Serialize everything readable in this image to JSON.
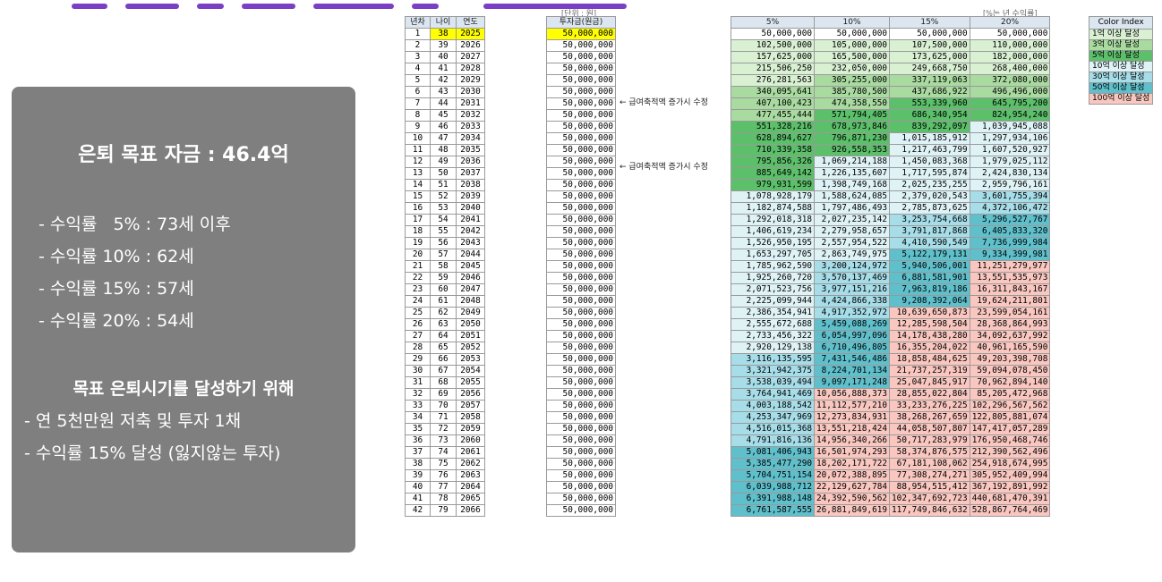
{
  "panel": {
    "title": "은퇴 목표 자금 : 46.4억",
    "rates": [
      "- 수익률   5% : 73세 이후",
      "- 수익률 10% : 62세",
      "- 수익률 15% : 57세",
      "- 수익률 20% : 54세"
    ],
    "goal_heading": "목표 은퇴시기를 달성하기 위해",
    "goals": [
      "- 연 5천만원 저축 및 투자 1채",
      "- 수익률 15% 달성 (잃지않는 투자)"
    ]
  },
  "sheet": {
    "unit_label": "[단위 : 원]",
    "rate_note": "[%는 년 수익률]",
    "headers_left": [
      "년차",
      "나이",
      "연도"
    ],
    "header_invest": "투자금(원금)",
    "headers_rate": [
      "5%",
      "10%",
      "15%",
      "20%"
    ],
    "notes": [
      "← 급여축적액 증가시 수정",
      "← 급여축적액 증가시 수정"
    ],
    "highlight_color": "#ffff00",
    "rows": [
      [
        "1",
        "38",
        "2025",
        "50,000,000",
        "50,000,000",
        "50,000,000",
        "50,000,000",
        "50,000,000"
      ],
      [
        "2",
        "39",
        "2026",
        "50,000,000",
        "102,500,000",
        "105,000,000",
        "107,500,000",
        "110,000,000"
      ],
      [
        "3",
        "40",
        "2027",
        "50,000,000",
        "157,625,000",
        "165,500,000",
        "173,625,000",
        "182,000,000"
      ],
      [
        "4",
        "41",
        "2028",
        "50,000,000",
        "215,506,250",
        "232,050,000",
        "249,668,750",
        "268,400,000"
      ],
      [
        "5",
        "42",
        "2029",
        "50,000,000",
        "276,281,563",
        "305,255,000",
        "337,119,063",
        "372,080,000"
      ],
      [
        "6",
        "43",
        "2030",
        "50,000,000",
        "340,095,641",
        "385,780,500",
        "437,686,922",
        "496,496,000"
      ],
      [
        "7",
        "44",
        "2031",
        "50,000,000",
        "407,100,423",
        "474,358,550",
        "553,339,960",
        "645,795,200"
      ],
      [
        "8",
        "45",
        "2032",
        "50,000,000",
        "477,455,444",
        "571,794,405",
        "686,340,954",
        "824,954,240"
      ],
      [
        "9",
        "46",
        "2033",
        "50,000,000",
        "551,328,216",
        "678,973,846",
        "839,292,097",
        "1,039,945,088"
      ],
      [
        "10",
        "47",
        "2034",
        "50,000,000",
        "628,894,627",
        "796,871,230",
        "1,015,185,912",
        "1,297,934,106"
      ],
      [
        "11",
        "48",
        "2035",
        "50,000,000",
        "710,339,358",
        "926,558,353",
        "1,217,463,799",
        "1,607,520,927"
      ],
      [
        "12",
        "49",
        "2036",
        "50,000,000",
        "795,856,326",
        "1,069,214,188",
        "1,450,083,368",
        "1,979,025,112"
      ],
      [
        "13",
        "50",
        "2037",
        "50,000,000",
        "885,649,142",
        "1,226,135,607",
        "1,717,595,874",
        "2,424,830,134"
      ],
      [
        "14",
        "51",
        "2038",
        "50,000,000",
        "979,931,599",
        "1,398,749,168",
        "2,025,235,255",
        "2,959,796,161"
      ],
      [
        "15",
        "52",
        "2039",
        "50,000,000",
        "1,078,928,179",
        "1,588,624,085",
        "2,379,020,543",
        "3,601,755,394"
      ],
      [
        "16",
        "53",
        "2040",
        "50,000,000",
        "1,182,874,588",
        "1,797,486,493",
        "2,785,873,625",
        "4,372,106,472"
      ],
      [
        "17",
        "54",
        "2041",
        "50,000,000",
        "1,292,018,318",
        "2,027,235,142",
        "3,253,754,668",
        "5,296,527,767"
      ],
      [
        "18",
        "55",
        "2042",
        "50,000,000",
        "1,406,619,234",
        "2,279,958,657",
        "3,791,817,868",
        "6,405,833,320"
      ],
      [
        "19",
        "56",
        "2043",
        "50,000,000",
        "1,526,950,195",
        "2,557,954,522",
        "4,410,590,549",
        "7,736,999,984"
      ],
      [
        "20",
        "57",
        "2044",
        "50,000,000",
        "1,653,297,705",
        "2,863,749,975",
        "5,122,179,131",
        "9,334,399,981"
      ],
      [
        "21",
        "58",
        "2045",
        "50,000,000",
        "1,785,962,590",
        "3,200,124,972",
        "5,940,506,001",
        "11,251,279,977"
      ],
      [
        "22",
        "59",
        "2046",
        "50,000,000",
        "1,925,260,720",
        "3,570,137,469",
        "6,881,581,901",
        "13,551,535,973"
      ],
      [
        "23",
        "60",
        "2047",
        "50,000,000",
        "2,071,523,756",
        "3,977,151,216",
        "7,963,819,186",
        "16,311,843,167"
      ],
      [
        "24",
        "61",
        "2048",
        "50,000,000",
        "2,225,099,944",
        "4,424,866,338",
        "9,208,392,064",
        "19,624,211,801"
      ],
      [
        "25",
        "62",
        "2049",
        "50,000,000",
        "2,386,354,941",
        "4,917,352,972",
        "10,639,650,873",
        "23,599,054,161"
      ],
      [
        "26",
        "63",
        "2050",
        "50,000,000",
        "2,555,672,688",
        "5,459,088,269",
        "12,285,598,504",
        "28,368,864,993"
      ],
      [
        "27",
        "64",
        "2051",
        "50,000,000",
        "2,733,456,322",
        "6,054,997,096",
        "14,178,438,280",
        "34,092,637,992"
      ],
      [
        "28",
        "65",
        "2052",
        "50,000,000",
        "2,920,129,138",
        "6,710,496,805",
        "16,355,204,022",
        "40,961,165,590"
      ],
      [
        "29",
        "66",
        "2053",
        "50,000,000",
        "3,116,135,595",
        "7,431,546,486",
        "18,858,484,625",
        "49,203,398,708"
      ],
      [
        "30",
        "67",
        "2054",
        "50,000,000",
        "3,321,942,375",
        "8,224,701,134",
        "21,737,257,319",
        "59,094,078,450"
      ],
      [
        "31",
        "68",
        "2055",
        "50,000,000",
        "3,538,039,494",
        "9,097,171,248",
        "25,047,845,917",
        "70,962,894,140"
      ],
      [
        "32",
        "69",
        "2056",
        "50,000,000",
        "3,764,941,469",
        "10,056,888,373",
        "28,855,022,804",
        "85,205,472,968"
      ],
      [
        "33",
        "70",
        "2057",
        "50,000,000",
        "4,003,188,542",
        "11,112,577,210",
        "33,233,276,225",
        "102,296,567,562"
      ],
      [
        "34",
        "71",
        "2058",
        "50,000,000",
        "4,253,347,969",
        "12,273,834,931",
        "38,268,267,659",
        "122,805,881,074"
      ],
      [
        "35",
        "72",
        "2059",
        "50,000,000",
        "4,516,015,368",
        "13,551,218,424",
        "44,058,507,807",
        "147,417,057,289"
      ],
      [
        "36",
        "73",
        "2060",
        "50,000,000",
        "4,791,816,136",
        "14,956,340,266",
        "50,717,283,979",
        "176,950,468,746"
      ],
      [
        "37",
        "74",
        "2061",
        "50,000,000",
        "5,081,406,943",
        "16,501,974,293",
        "58,374,876,575",
        "212,390,562,496"
      ],
      [
        "38",
        "75",
        "2062",
        "50,000,000",
        "5,385,477,290",
        "18,202,171,722",
        "67,181,108,062",
        "254,918,674,995"
      ],
      [
        "39",
        "76",
        "2063",
        "50,000,000",
        "5,704,751,154",
        "20,072,388,895",
        "77,308,274,271",
        "305,952,409,994"
      ],
      [
        "40",
        "77",
        "2064",
        "50,000,000",
        "6,039,988,712",
        "22,129,627,784",
        "88,954,515,412",
        "367,192,891,992"
      ],
      [
        "41",
        "78",
        "2065",
        "50,000,000",
        "6,391,988,148",
        "24,392,590,562",
        "102,347,692,723",
        "440,681,470,391"
      ],
      [
        "42",
        "79",
        "2066",
        "50,000,000",
        "6,761,587,555",
        "26,881,849,619",
        "117,749,846,632",
        "528,867,764,469"
      ]
    ],
    "legend_header": "Color Index",
    "legend": [
      {
        "label": "1억 이상 달성",
        "color": "#d9f0d3"
      },
      {
        "label": "3억 이상 달성",
        "color": "#a9dba0"
      },
      {
        "label": "5억 이상 달성",
        "color": "#5cbf6a"
      },
      {
        "label": "10억 이상 달성",
        "color": "#dff3f7"
      },
      {
        "label": "30억 이상 달성",
        "color": "#a6dde8"
      },
      {
        "label": "50억 이상 달성",
        "color": "#5fc0cc"
      },
      {
        "label": "100억 이상 달성",
        "color": "#f9c7c0"
      }
    ]
  }
}
